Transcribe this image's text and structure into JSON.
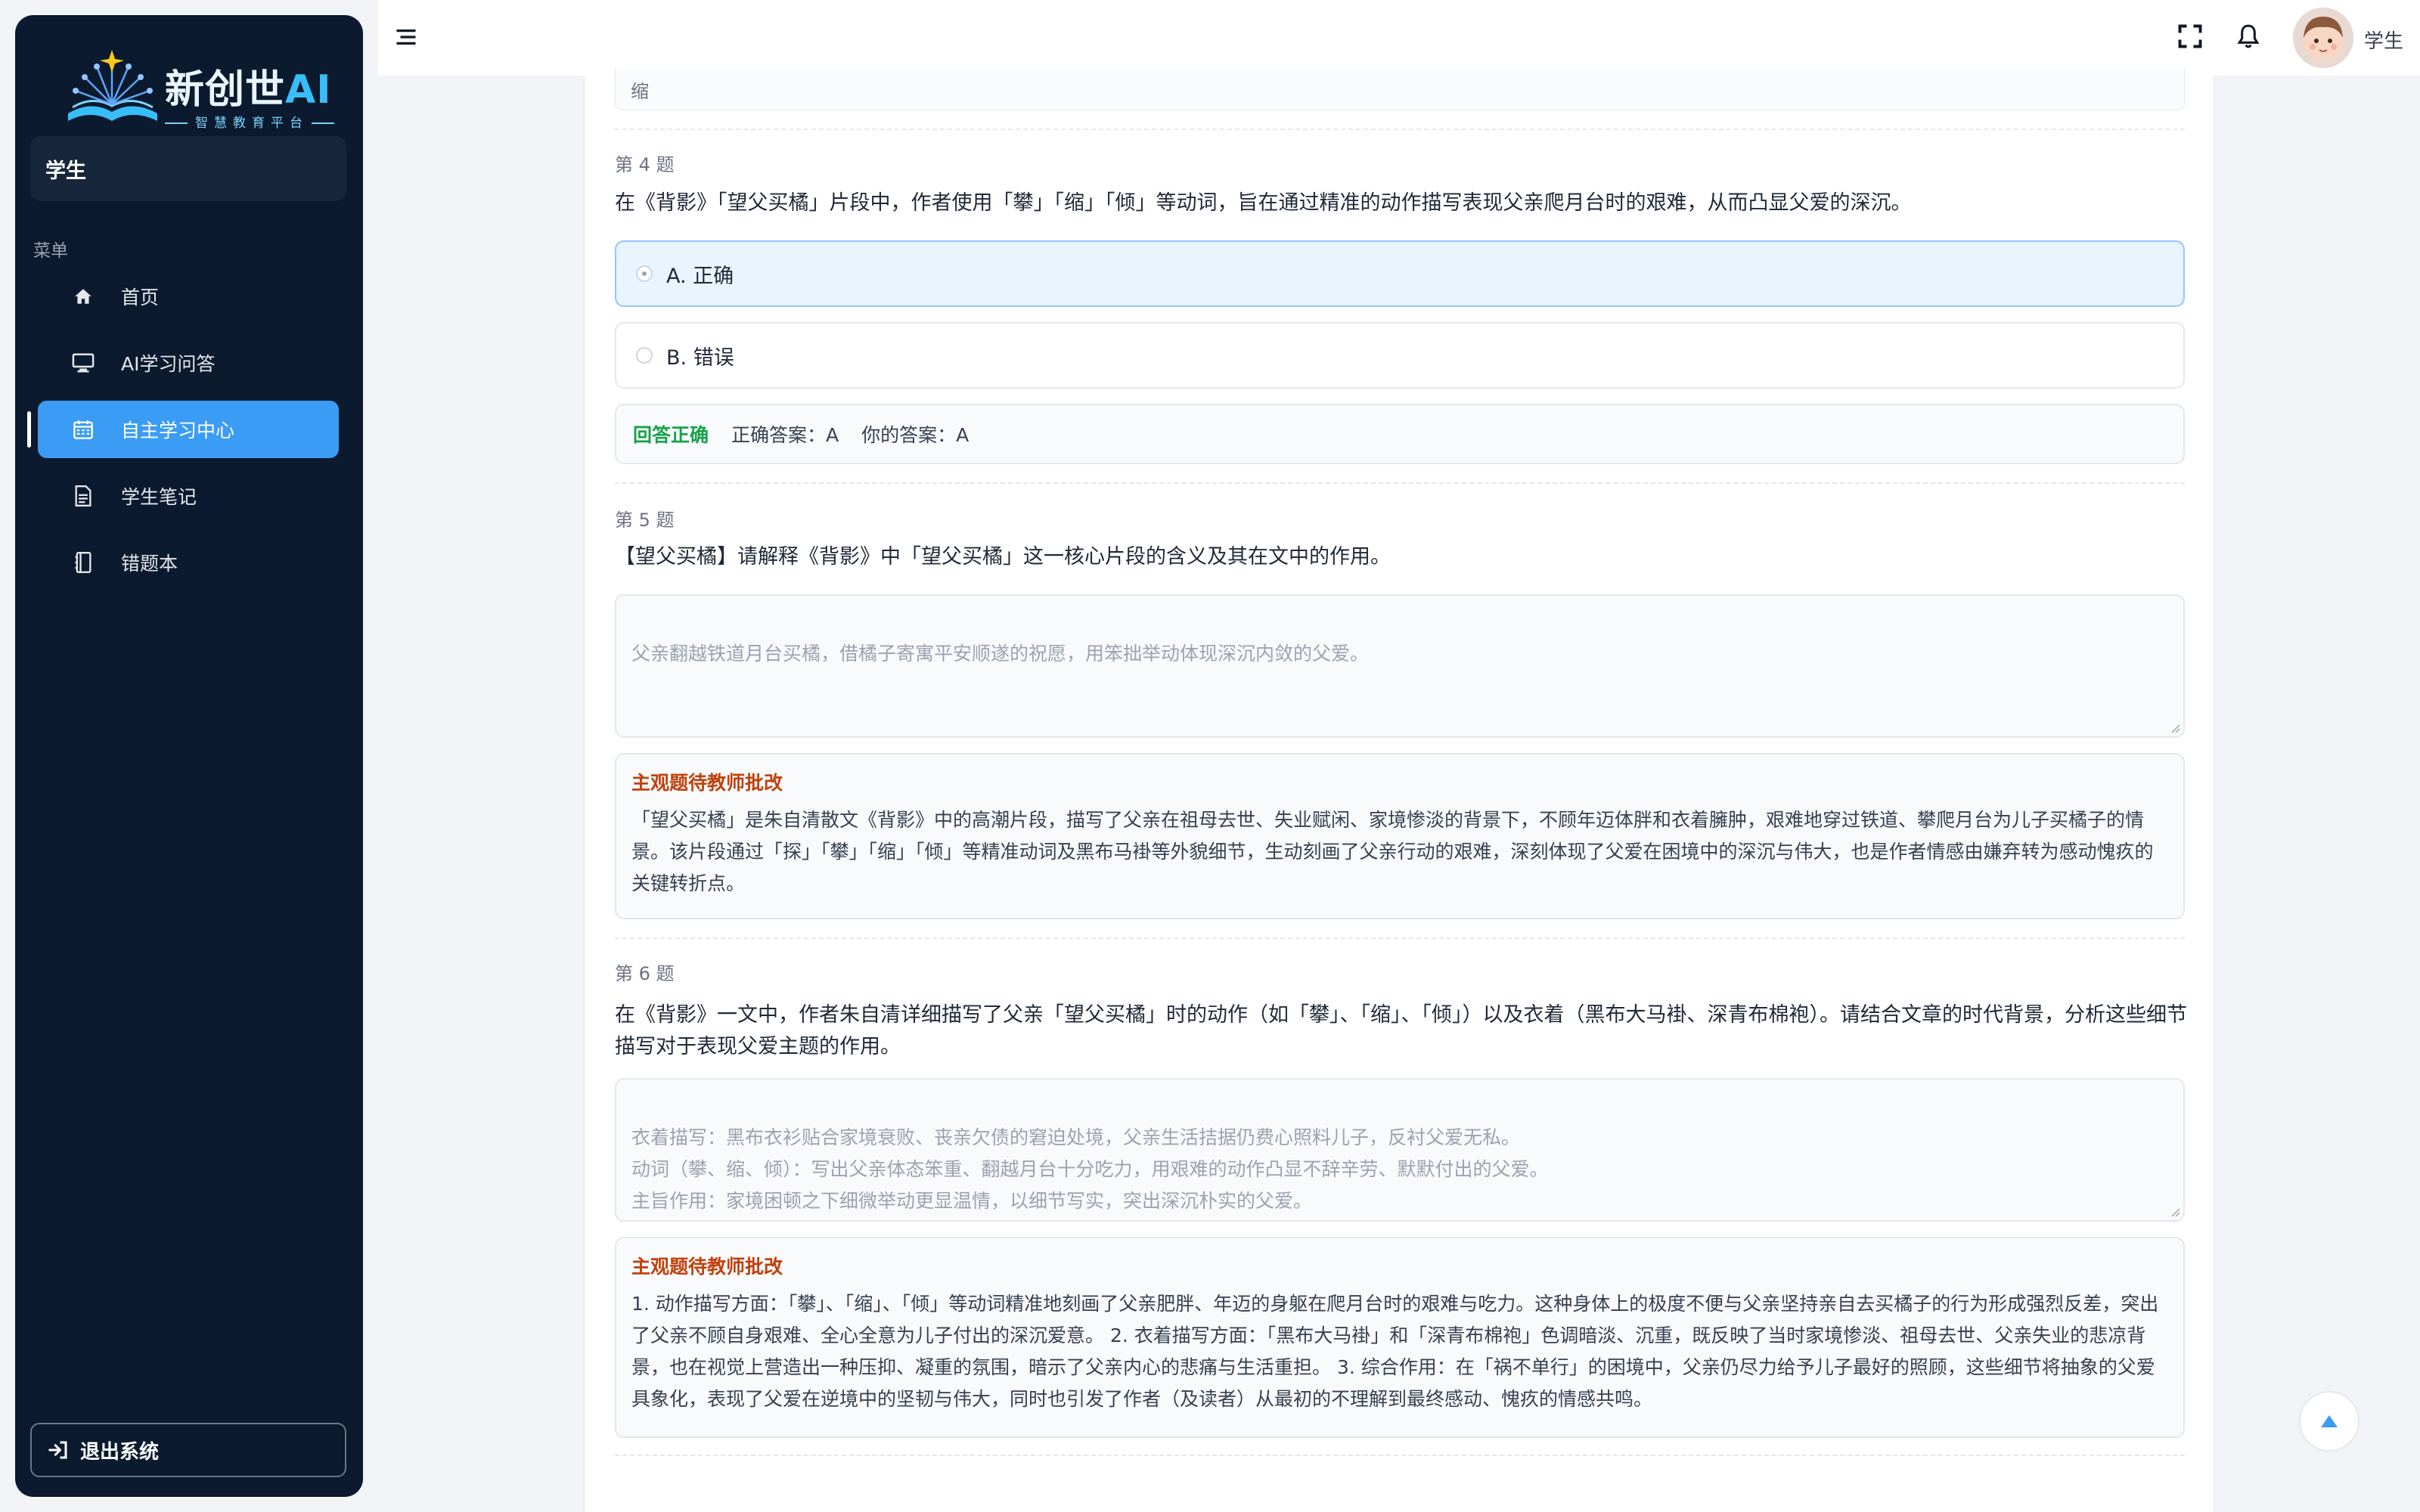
{
  "brand": {
    "title_main": "新创世",
    "title_ai": "AI",
    "subtitle": "智慧教育平台"
  },
  "sidebar": {
    "role": "学生",
    "menu_label": "菜单",
    "items": [
      {
        "label": "首页",
        "icon": "home-icon"
      },
      {
        "label": "AI学习问答",
        "icon": "monitor-icon"
      },
      {
        "label": "自主学习中心",
        "icon": "calendar-icon",
        "active": true
      },
      {
        "label": "学生笔记",
        "icon": "document-icon"
      },
      {
        "label": "错题本",
        "icon": "notebook-icon"
      }
    ],
    "logout_label": "退出系统"
  },
  "header": {
    "user_name": "学生"
  },
  "content": {
    "previous_tail": "缩",
    "q4": {
      "number": "第 4 题",
      "text": "在《背影》「望父买橘」片段中，作者使用「攀」「缩」「倾」等动词，旨在通过精准的动作描写表现父亲爬月台时的艰难，从而凸显父爱的深沉。",
      "options": [
        {
          "label": "A. 正确",
          "selected": true
        },
        {
          "label": "B. 错误",
          "selected": false
        }
      ],
      "result": "回答正确",
      "correct_answer": "正确答案：A",
      "your_answer": "你的答案：A"
    },
    "q5": {
      "number": "第 5 题",
      "text": "【望父买橘】请解释《背影》中「望父买橘」这一核心片段的含义及其在文中的作用。",
      "answer": "父亲翻越铁道月台买橘，借橘子寄寓平安顺遂的祝愿，用笨拙举动体现深沉内敛的父爱。",
      "review_title": "主观题待教师批改",
      "review_text": "「望父买橘」是朱自清散文《背影》中的高潮片段，描写了父亲在祖母去世、失业赋闲、家境惨淡的背景下，不顾年迈体胖和衣着臃肿，艰难地穿过铁道、攀爬月台为儿子买橘子的情景。该片段通过「探」「攀」「缩」「倾」等精准动词及黑布马褂等外貌细节，生动刻画了父亲行动的艰难，深刻体现了父爱在困境中的深沉与伟大，也是作者情感由嫌弃转为感动愧疚的关键转折点。"
    },
    "q6": {
      "number": "第 6 题",
      "text": "在《背影》一文中，作者朱自清详细描写了父亲「望父买橘」时的动作（如「攀」、「缩」、「倾」）以及衣着（黑布大马褂、深青布棉袍）。请结合文章的时代背景，分析这些细节描写对于表现父爱主题的作用。",
      "answer": "衣着描写：黑布衣衫贴合家境衰败、丧亲欠债的窘迫处境，父亲生活拮据仍费心照料儿子，反衬父爱无私。\n动词（攀、缩、倾）：写出父亲体态笨重、翻越月台十分吃力，用艰难的动作凸显不辞辛劳、默默付出的父爱。\n主旨作用：家境困顿之下细微举动更显温情，以细节写实，突出深沉朴实的父爱。",
      "review_title": "主观题待教师批改",
      "review_text": "1. 动作描写方面：「攀」、「缩」、「倾」等动词精准地刻画了父亲肥胖、年迈的身躯在爬月台时的艰难与吃力。这种身体上的极度不便与父亲坚持亲自去买橘子的行为形成强烈反差，突出了父亲不顾自身艰难、全心全意为儿子付出的深沉爱意。 2. 衣着描写方面：「黑布大马褂」和「深青布棉袍」色调暗淡、沉重，既反映了当时家境惨淡、祖母去世、父亲失业的悲凉背景，也在视觉上营造出一种压抑、凝重的氛围，暗示了父亲内心的悲痛与生活重担。 3. 综合作用：在「祸不单行」的困境中，父亲仍尽力给予儿子最好的照顾，这些细节将抽象的父爱具象化，表现了父爱在逆境中的坚韧与伟大，同时也引发了作者（及读者）从最初的不理解到最终感动、愧疚的情感共鸣。"
    }
  },
  "colors": {
    "sidebar_bg": "#0b1a2e",
    "active_item": "#3b9cf5",
    "success": "#16a34a",
    "review_title": "#c2410c"
  }
}
